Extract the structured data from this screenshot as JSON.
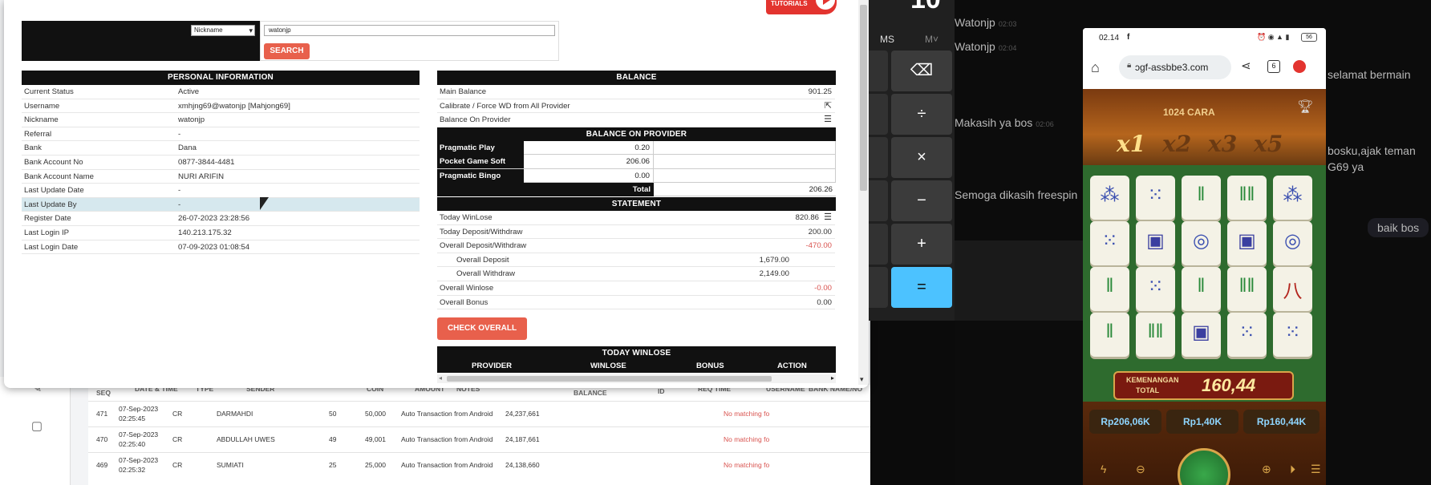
{
  "background_page": {
    "columns": [
      "SEQ",
      "DATE & TIME",
      "TYPE",
      "SENDER",
      "COIN",
      "AMOUNT",
      "NOTES",
      "BALANCE",
      "ID",
      "REQ TIME",
      "USERNAME",
      "BANK NAME/NO"
    ],
    "rows": [
      {
        "seq": "471",
        "date": "07-Sep-2023",
        "time": "02:25:45",
        "type": "CR",
        "sender": "DARMAHDI",
        "coin": "50",
        "amount": "50,000",
        "notes": "Auto Transaction from Android",
        "balance": "24,237,661",
        "status": "No matching fo"
      },
      {
        "seq": "470",
        "date": "07-Sep-2023",
        "time": "02:25:40",
        "type": "CR",
        "sender": "ABDULLAH UWES",
        "coin": "49",
        "amount": "49,001",
        "notes": "Auto Transaction from Android",
        "balance": "24,187,661",
        "status": "No matching fo"
      },
      {
        "seq": "469",
        "date": "07-Sep-2023",
        "time": "02:25:32",
        "type": "CR",
        "sender": "SUMIATI",
        "coin": "25",
        "amount": "25,000",
        "notes": "Auto Transaction from Android",
        "balance": "24,138,660",
        "status": "No matching fo"
      }
    ]
  },
  "modal": {
    "logo_text": "TUTORIALS",
    "search": {
      "field_option": "Nickname",
      "query": "watonjp",
      "button": "SEARCH"
    },
    "personal": {
      "title": "PERSONAL INFORMATION",
      "rows": [
        {
          "k": "Current Status",
          "v": "Active"
        },
        {
          "k": "Username",
          "v": "xmhjng69@watonjp  [Mahjong69]"
        },
        {
          "k": "Nickname",
          "v": "watonjp"
        },
        {
          "k": "Referral",
          "v": "-"
        },
        {
          "k": "Bank",
          "v": "Dana"
        },
        {
          "k": "Bank Account No",
          "v": "0877-3844-4481"
        },
        {
          "k": "Bank Account Name",
          "v": "NURI ARIFIN"
        },
        {
          "k": "Last Update Date",
          "v": "-"
        },
        {
          "k": "Last Update By",
          "v": "-"
        },
        {
          "k": "Register Date",
          "v": "26-07-2023 23:28:56"
        },
        {
          "k": "Last Login IP",
          "v": "140.213.175.32"
        },
        {
          "k": "Last Login Date",
          "v": "07-09-2023 01:08:54"
        }
      ]
    },
    "balance": {
      "title": "BALANCE",
      "main_label": "Main Balance",
      "main_value": "901.25",
      "calibrate_label": "Calibrate / Force WD from All Provider",
      "on_provider_label": "Balance On Provider",
      "provider_title": "BALANCE ON PROVIDER",
      "providers": [
        {
          "name": "Pragmatic Play",
          "value": "0.20"
        },
        {
          "name": "Pocket Game Soft",
          "value": "206.06"
        },
        {
          "name": "Pragmatic Bingo",
          "value": "0.00"
        }
      ],
      "total_label": "Total",
      "total_value": "206.26"
    },
    "statement": {
      "title": "STATEMENT",
      "today_winlose_label": "Today WinLose",
      "today_winlose": "820.86",
      "today_dw_label": "Today Deposit/Withdraw",
      "today_dw": "200.00",
      "overall_dw_label": "Overall Deposit/Withdraw",
      "overall_dw": "-470.00",
      "overall_deposit_label": "Overall Deposit",
      "overall_deposit": "1,679.00",
      "overall_withdraw_label": "Overall Withdraw",
      "overall_withdraw": "2,149.00",
      "overall_winlose_label": "Overall Winlose",
      "overall_winlose": "-0.00",
      "overall_bonus_label": "Overall Bonus",
      "overall_bonus": "0.00",
      "check_button": "CHECK OVERALL"
    },
    "today_winlose": {
      "title": "TODAY WINLOSE",
      "columns": [
        "PROVIDER",
        "WINLOSE",
        "BONUS",
        "ACTION"
      ]
    }
  },
  "calculator": {
    "display_digit": "10",
    "memory": [
      "MS",
      "M˅"
    ],
    "keys": [
      "⌫",
      "÷",
      "×",
      "−",
      "+",
      "="
    ]
  },
  "chat": [
    {
      "text": "Watonjp",
      "time": "02:03"
    },
    {
      "text": "Watonjp",
      "time": "02:04"
    },
    {
      "text": "Makasih ya bos",
      "time": "02:06"
    },
    {
      "text": "Semoga dikasih freespin",
      "time": ""
    },
    {
      "text": "selamat bermain",
      "time": ""
    },
    {
      "text": "bosku,ajak teman",
      "time": ""
    },
    {
      "text": "G69 ya",
      "time": ""
    },
    {
      "text": "baik bos",
      "time": ""
    }
  ],
  "phone": {
    "time": "02.14",
    "battery": "56",
    "url": "ɔgf-assbbe3.com",
    "tab_count": "6",
    "game": {
      "ways_label": "1024 CARA",
      "multipliers": [
        "x1",
        "x2",
        "x3",
        "x5"
      ],
      "win_label_1": "KEMENANGAN",
      "win_label_2": "TOTAL",
      "win_value": "160,44",
      "balance": "Rp206,06K",
      "bet": "Rp1,40K",
      "win": "Rp160,44K",
      "tiles": [
        [
          "dots3",
          "dots5",
          "bamboo2",
          "bamboo4",
          "dots3"
        ],
        [
          "dots5",
          "frame",
          "dots1",
          "frame",
          "dots1"
        ],
        [
          "bamboo2",
          "dots5",
          "bamboo2",
          "bamboo4",
          "wan8"
        ],
        [
          "bamboo2",
          "bamboo4",
          "frame",
          "dots5",
          "dots5"
        ]
      ]
    }
  },
  "colors": {
    "accent": "#e8604c",
    "header": "#111111",
    "calc_equals": "#4cc2ff",
    "game_green": "#2e6b2e",
    "game_gold": "#c9932e"
  }
}
